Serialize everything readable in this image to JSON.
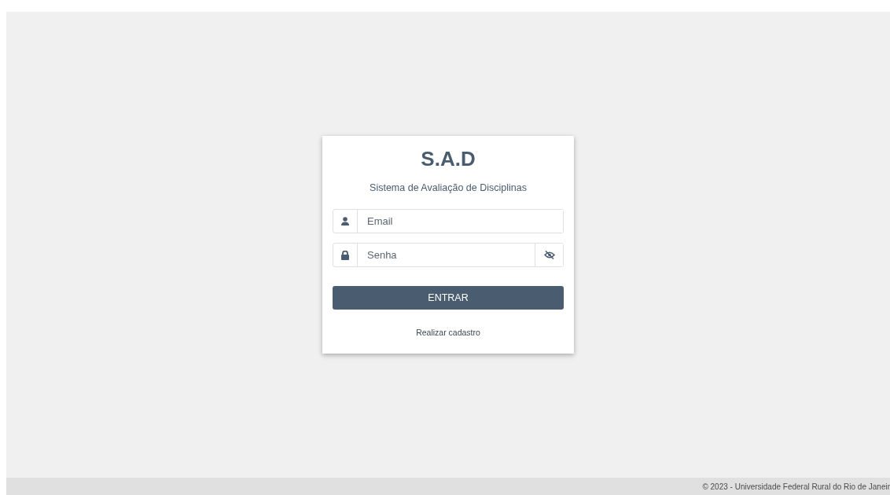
{
  "login": {
    "title": "S.A.D",
    "subtitle": "Sistema de Avaliação de Disciplinas",
    "email": {
      "placeholder": "Email"
    },
    "password": {
      "placeholder": "Senha"
    },
    "submit": "ENTRAR",
    "register_link": "Realizar cadastro"
  },
  "footer": "© 2023 - Universidade Federal Rural do Rio de Janeir"
}
